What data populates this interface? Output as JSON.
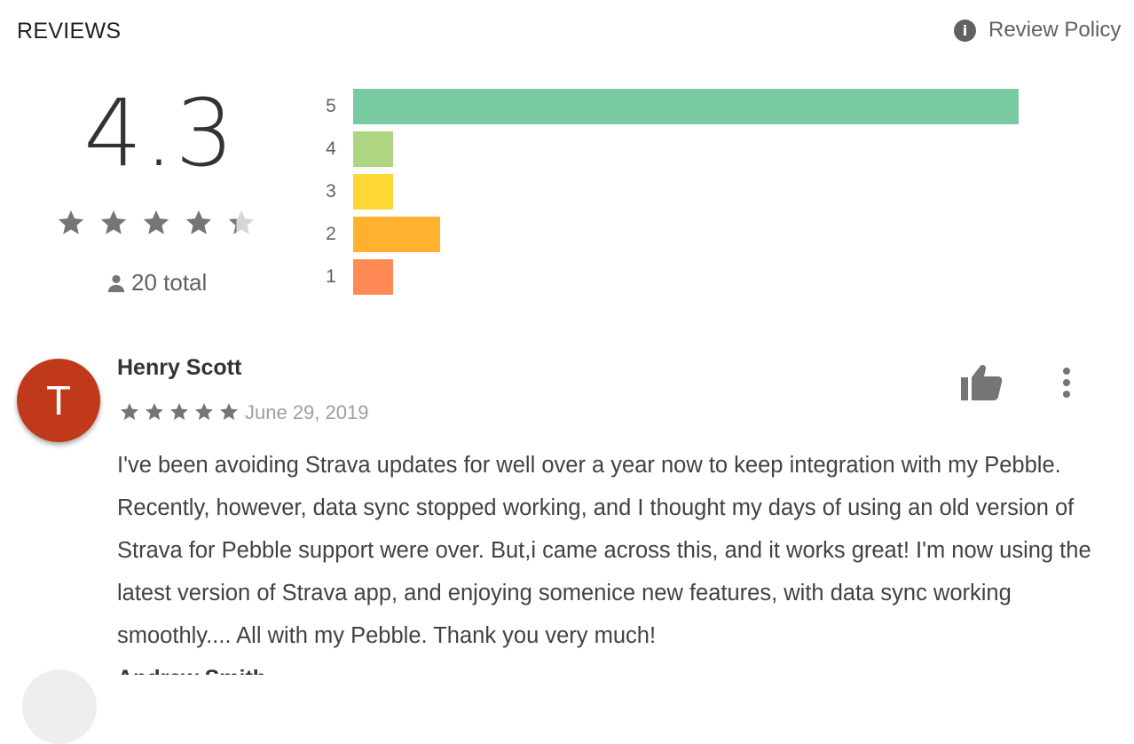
{
  "header": {
    "title": "REVIEWS",
    "policy_label": "Review Policy"
  },
  "summary": {
    "average": "4.3",
    "stars_filled": 4.3,
    "total_text": "20 total"
  },
  "histogram": [
    {
      "label": "5",
      "fraction": 1.0,
      "color": "#79c9a1"
    },
    {
      "label": "4",
      "fraction": 0.06,
      "color": "#aed581"
    },
    {
      "label": "3",
      "fraction": 0.06,
      "color": "#fdd835"
    },
    {
      "label": "2",
      "fraction": 0.13,
      "color": "#ffb12f"
    },
    {
      "label": "1",
      "fraction": 0.06,
      "color": "#ff8a55"
    }
  ],
  "review": {
    "avatar_letter": "T",
    "name": "Henry Scott",
    "rating": 5,
    "date": "June 29, 2019",
    "text": "I've been avoiding Strava updates for well over a year now to keep integration with my Pebble. Recently, however, data sync stopped working, and I thought my days of using an old version of Strava for Pebble support were over. But,i came across this, and it works great! I'm now using the latest version of Strava app, and enjoying somenice new features, with data sync working smoothly.... All with my Pebble. Thank you very much!"
  },
  "next_review": {
    "name": "Andrew Smith"
  },
  "icons": {
    "policy": "info-icon",
    "total": "person-icon",
    "helpful": "thumbs-up-icon",
    "menu": "more-vert-icon"
  }
}
